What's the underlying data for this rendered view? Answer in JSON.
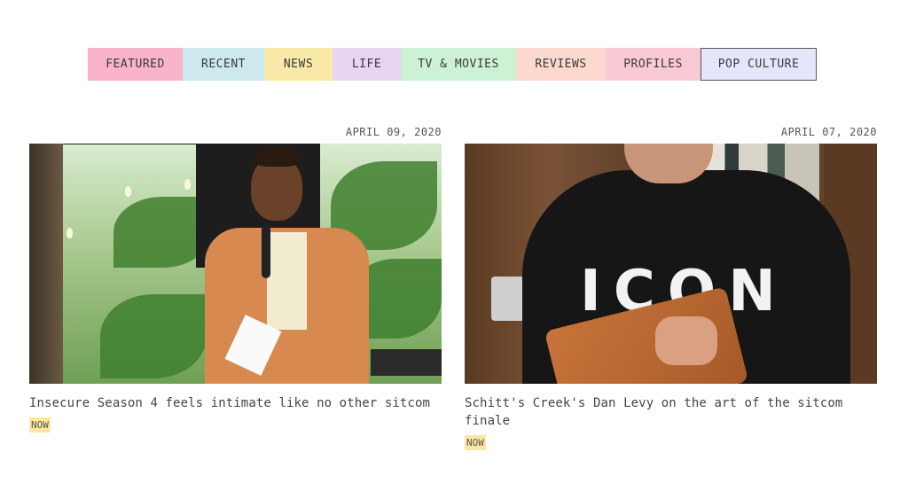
{
  "nav": {
    "items": [
      {
        "label": "FEATURED",
        "color": "#f9b4c9",
        "width": 107
      },
      {
        "label": "RECENT",
        "color": "#cde8ee",
        "width": 92
      },
      {
        "label": "NEWS",
        "color": "#f9e9a8",
        "width": 77
      },
      {
        "label": "LIFE",
        "color": "#e8d4f3",
        "width": 77
      },
      {
        "label": "TV & MOVIES",
        "color": "#cdf1d4",
        "width": 130
      },
      {
        "label": "REVIEWS",
        "color": "#fbd9cf",
        "width": 101
      },
      {
        "label": "PROFILES",
        "color": "#f9c9d6",
        "width": 107
      },
      {
        "label": "POP CULTURE",
        "color": "#e4e6fb",
        "width": 131,
        "active": true
      }
    ]
  },
  "articles": [
    {
      "date": "APRIL 09, 2020",
      "headline": "Insecure Season 4 feels intimate like no other sitcom",
      "badge": "NOW",
      "image": "woman-with-microphone-photo"
    },
    {
      "date": "APRIL 07, 2020",
      "headline": "Schitt's Creek's Dan Levy on the art of the sitcom finale",
      "badge": "NOW",
      "image": "man-in-icon-sweater-photo",
      "shirt_text": "ICON"
    }
  ],
  "colors": {
    "badge": "#fbe8a0",
    "active_border": "#555555"
  }
}
